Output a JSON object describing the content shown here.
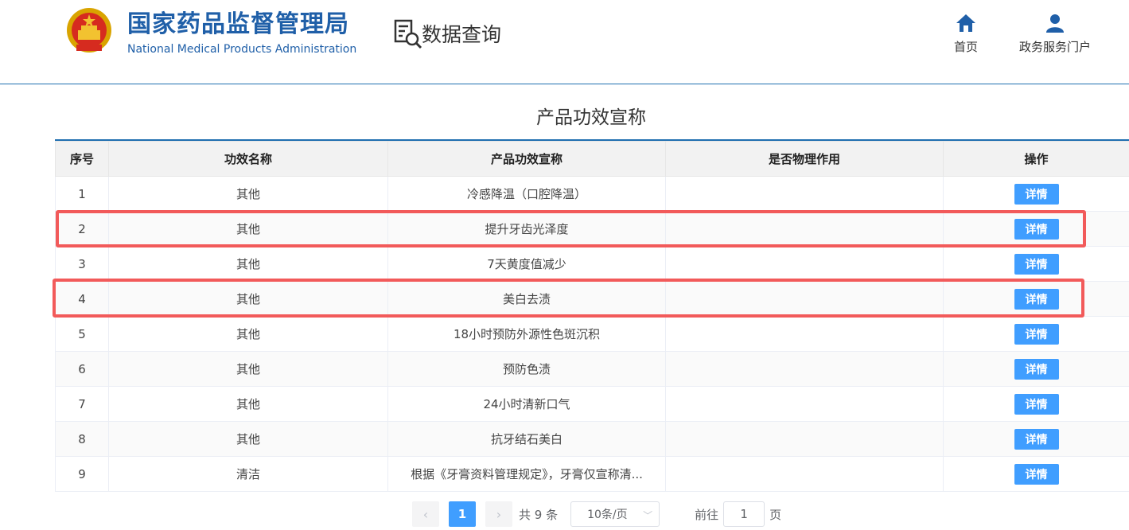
{
  "header": {
    "org_name_cn": "国家药品监督管理局",
    "org_name_en": "National Medical Products Administration",
    "query_label": "数据查询",
    "nav": {
      "home_label": "首页",
      "portal_label": "政务服务门户"
    }
  },
  "page": {
    "title": "产品功效宣称"
  },
  "table": {
    "headers": [
      "序号",
      "功效名称",
      "产品功效宣称",
      "是否物理作用",
      "操作"
    ],
    "rows": [
      {
        "index": "1",
        "category": "其他",
        "claim": "冷感降温（口腔降温）",
        "physical": "",
        "action": "详情"
      },
      {
        "index": "2",
        "category": "其他",
        "claim": "提升牙齿光泽度",
        "physical": "",
        "action": "详情"
      },
      {
        "index": "3",
        "category": "其他",
        "claim": "7天黄度值减少",
        "physical": "",
        "action": "详情"
      },
      {
        "index": "4",
        "category": "其他",
        "claim": "美白去渍",
        "physical": "",
        "action": "详情"
      },
      {
        "index": "5",
        "category": "其他",
        "claim": "18小时预防外源性色斑沉积",
        "physical": "",
        "action": "详情"
      },
      {
        "index": "6",
        "category": "其他",
        "claim": "预防色渍",
        "physical": "",
        "action": "详情"
      },
      {
        "index": "7",
        "category": "其他",
        "claim": "24小时清新口气",
        "physical": "",
        "action": "详情"
      },
      {
        "index": "8",
        "category": "其他",
        "claim": "抗牙结石美白",
        "physical": "",
        "action": "详情"
      },
      {
        "index": "9",
        "category": "清洁",
        "claim": "根据《牙膏资料管理规定》，牙膏仅宣称清...",
        "physical": "",
        "action": "详情"
      }
    ]
  },
  "pagination": {
    "prev": "‹",
    "current_page": "1",
    "next": "›",
    "total_text": "共 9 条",
    "page_size": "10条/页",
    "goto_label": "前往",
    "goto_value": "1",
    "page_suffix": "页"
  },
  "colors": {
    "brand": "#1f5fa8",
    "button": "#409eff",
    "highlight": "#f25a5a"
  }
}
